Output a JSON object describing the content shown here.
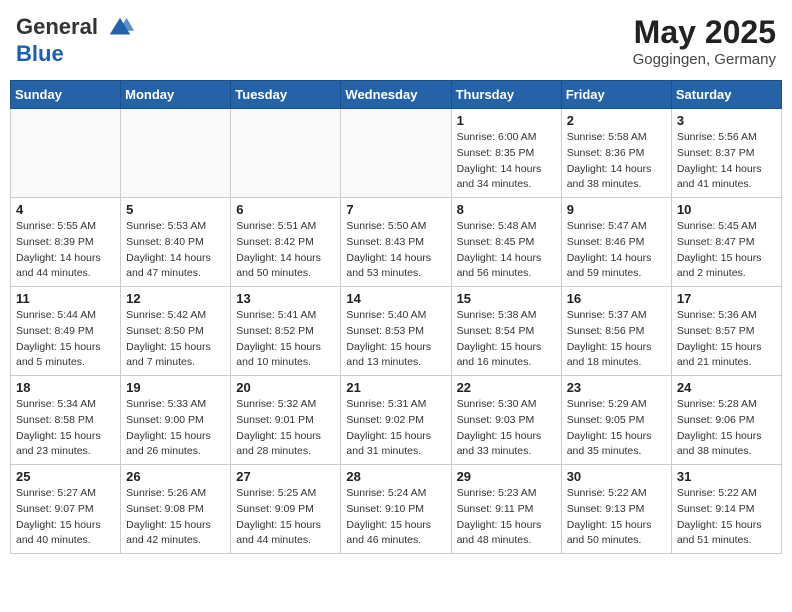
{
  "header": {
    "logo_line1": "General",
    "logo_line2": "Blue",
    "month_year": "May 2025",
    "location": "Goggingen, Germany"
  },
  "weekdays": [
    "Sunday",
    "Monday",
    "Tuesday",
    "Wednesday",
    "Thursday",
    "Friday",
    "Saturday"
  ],
  "weeks": [
    [
      {
        "day": "",
        "detail": ""
      },
      {
        "day": "",
        "detail": ""
      },
      {
        "day": "",
        "detail": ""
      },
      {
        "day": "",
        "detail": ""
      },
      {
        "day": "1",
        "detail": "Sunrise: 6:00 AM\nSunset: 8:35 PM\nDaylight: 14 hours\nand 34 minutes."
      },
      {
        "day": "2",
        "detail": "Sunrise: 5:58 AM\nSunset: 8:36 PM\nDaylight: 14 hours\nand 38 minutes."
      },
      {
        "day": "3",
        "detail": "Sunrise: 5:56 AM\nSunset: 8:37 PM\nDaylight: 14 hours\nand 41 minutes."
      }
    ],
    [
      {
        "day": "4",
        "detail": "Sunrise: 5:55 AM\nSunset: 8:39 PM\nDaylight: 14 hours\nand 44 minutes."
      },
      {
        "day": "5",
        "detail": "Sunrise: 5:53 AM\nSunset: 8:40 PM\nDaylight: 14 hours\nand 47 minutes."
      },
      {
        "day": "6",
        "detail": "Sunrise: 5:51 AM\nSunset: 8:42 PM\nDaylight: 14 hours\nand 50 minutes."
      },
      {
        "day": "7",
        "detail": "Sunrise: 5:50 AM\nSunset: 8:43 PM\nDaylight: 14 hours\nand 53 minutes."
      },
      {
        "day": "8",
        "detail": "Sunrise: 5:48 AM\nSunset: 8:45 PM\nDaylight: 14 hours\nand 56 minutes."
      },
      {
        "day": "9",
        "detail": "Sunrise: 5:47 AM\nSunset: 8:46 PM\nDaylight: 14 hours\nand 59 minutes."
      },
      {
        "day": "10",
        "detail": "Sunrise: 5:45 AM\nSunset: 8:47 PM\nDaylight: 15 hours\nand 2 minutes."
      }
    ],
    [
      {
        "day": "11",
        "detail": "Sunrise: 5:44 AM\nSunset: 8:49 PM\nDaylight: 15 hours\nand 5 minutes."
      },
      {
        "day": "12",
        "detail": "Sunrise: 5:42 AM\nSunset: 8:50 PM\nDaylight: 15 hours\nand 7 minutes."
      },
      {
        "day": "13",
        "detail": "Sunrise: 5:41 AM\nSunset: 8:52 PM\nDaylight: 15 hours\nand 10 minutes."
      },
      {
        "day": "14",
        "detail": "Sunrise: 5:40 AM\nSunset: 8:53 PM\nDaylight: 15 hours\nand 13 minutes."
      },
      {
        "day": "15",
        "detail": "Sunrise: 5:38 AM\nSunset: 8:54 PM\nDaylight: 15 hours\nand 16 minutes."
      },
      {
        "day": "16",
        "detail": "Sunrise: 5:37 AM\nSunset: 8:56 PM\nDaylight: 15 hours\nand 18 minutes."
      },
      {
        "day": "17",
        "detail": "Sunrise: 5:36 AM\nSunset: 8:57 PM\nDaylight: 15 hours\nand 21 minutes."
      }
    ],
    [
      {
        "day": "18",
        "detail": "Sunrise: 5:34 AM\nSunset: 8:58 PM\nDaylight: 15 hours\nand 23 minutes."
      },
      {
        "day": "19",
        "detail": "Sunrise: 5:33 AM\nSunset: 9:00 PM\nDaylight: 15 hours\nand 26 minutes."
      },
      {
        "day": "20",
        "detail": "Sunrise: 5:32 AM\nSunset: 9:01 PM\nDaylight: 15 hours\nand 28 minutes."
      },
      {
        "day": "21",
        "detail": "Sunrise: 5:31 AM\nSunset: 9:02 PM\nDaylight: 15 hours\nand 31 minutes."
      },
      {
        "day": "22",
        "detail": "Sunrise: 5:30 AM\nSunset: 9:03 PM\nDaylight: 15 hours\nand 33 minutes."
      },
      {
        "day": "23",
        "detail": "Sunrise: 5:29 AM\nSunset: 9:05 PM\nDaylight: 15 hours\nand 35 minutes."
      },
      {
        "day": "24",
        "detail": "Sunrise: 5:28 AM\nSunset: 9:06 PM\nDaylight: 15 hours\nand 38 minutes."
      }
    ],
    [
      {
        "day": "25",
        "detail": "Sunrise: 5:27 AM\nSunset: 9:07 PM\nDaylight: 15 hours\nand 40 minutes."
      },
      {
        "day": "26",
        "detail": "Sunrise: 5:26 AM\nSunset: 9:08 PM\nDaylight: 15 hours\nand 42 minutes."
      },
      {
        "day": "27",
        "detail": "Sunrise: 5:25 AM\nSunset: 9:09 PM\nDaylight: 15 hours\nand 44 minutes."
      },
      {
        "day": "28",
        "detail": "Sunrise: 5:24 AM\nSunset: 9:10 PM\nDaylight: 15 hours\nand 46 minutes."
      },
      {
        "day": "29",
        "detail": "Sunrise: 5:23 AM\nSunset: 9:11 PM\nDaylight: 15 hours\nand 48 minutes."
      },
      {
        "day": "30",
        "detail": "Sunrise: 5:22 AM\nSunset: 9:13 PM\nDaylight: 15 hours\nand 50 minutes."
      },
      {
        "day": "31",
        "detail": "Sunrise: 5:22 AM\nSunset: 9:14 PM\nDaylight: 15 hours\nand 51 minutes."
      }
    ]
  ]
}
